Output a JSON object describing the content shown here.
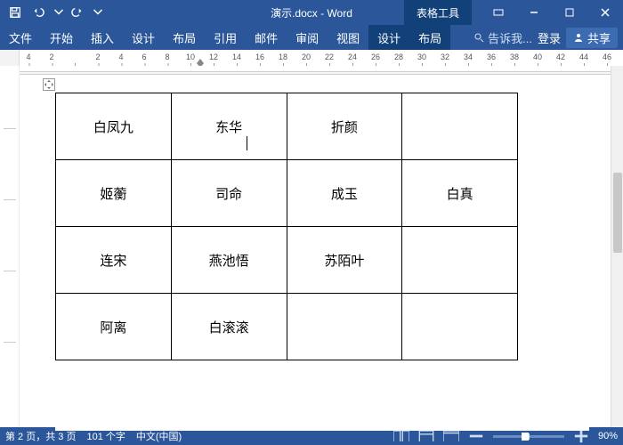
{
  "titlebar": {
    "title": "演示.docx - Word",
    "toolsTab": "表格工具"
  },
  "ribbon": {
    "tabs": [
      "文件",
      "开始",
      "插入",
      "设计",
      "布局",
      "引用",
      "邮件",
      "审阅",
      "视图"
    ],
    "contextual": [
      "设计",
      "布局"
    ],
    "tellMe": "告诉我...",
    "signIn": "登录",
    "share": "共享"
  },
  "ruler": {
    "marks": [
      "4",
      "2",
      "",
      "2",
      "4",
      "6",
      "8",
      "10",
      "12",
      "14",
      "16",
      "18",
      "20",
      "22",
      "24",
      "26",
      "28",
      "30",
      "32",
      "34",
      "36",
      "38",
      "40",
      "42",
      "44",
      "46"
    ]
  },
  "table": {
    "rows": [
      [
        "白凤九",
        "东华",
        "折颜",
        ""
      ],
      [
        "姬蘅",
        "司命",
        "成玉",
        "白真"
      ],
      [
        "连宋",
        "燕池悟",
        "苏陌叶",
        ""
      ],
      [
        "阿离",
        "白滚滚",
        "",
        ""
      ]
    ]
  },
  "status": {
    "page": "第 2 页，共 3 页",
    "words": "101 个字",
    "lang": "中文(中国)",
    "zoom": "90%"
  }
}
